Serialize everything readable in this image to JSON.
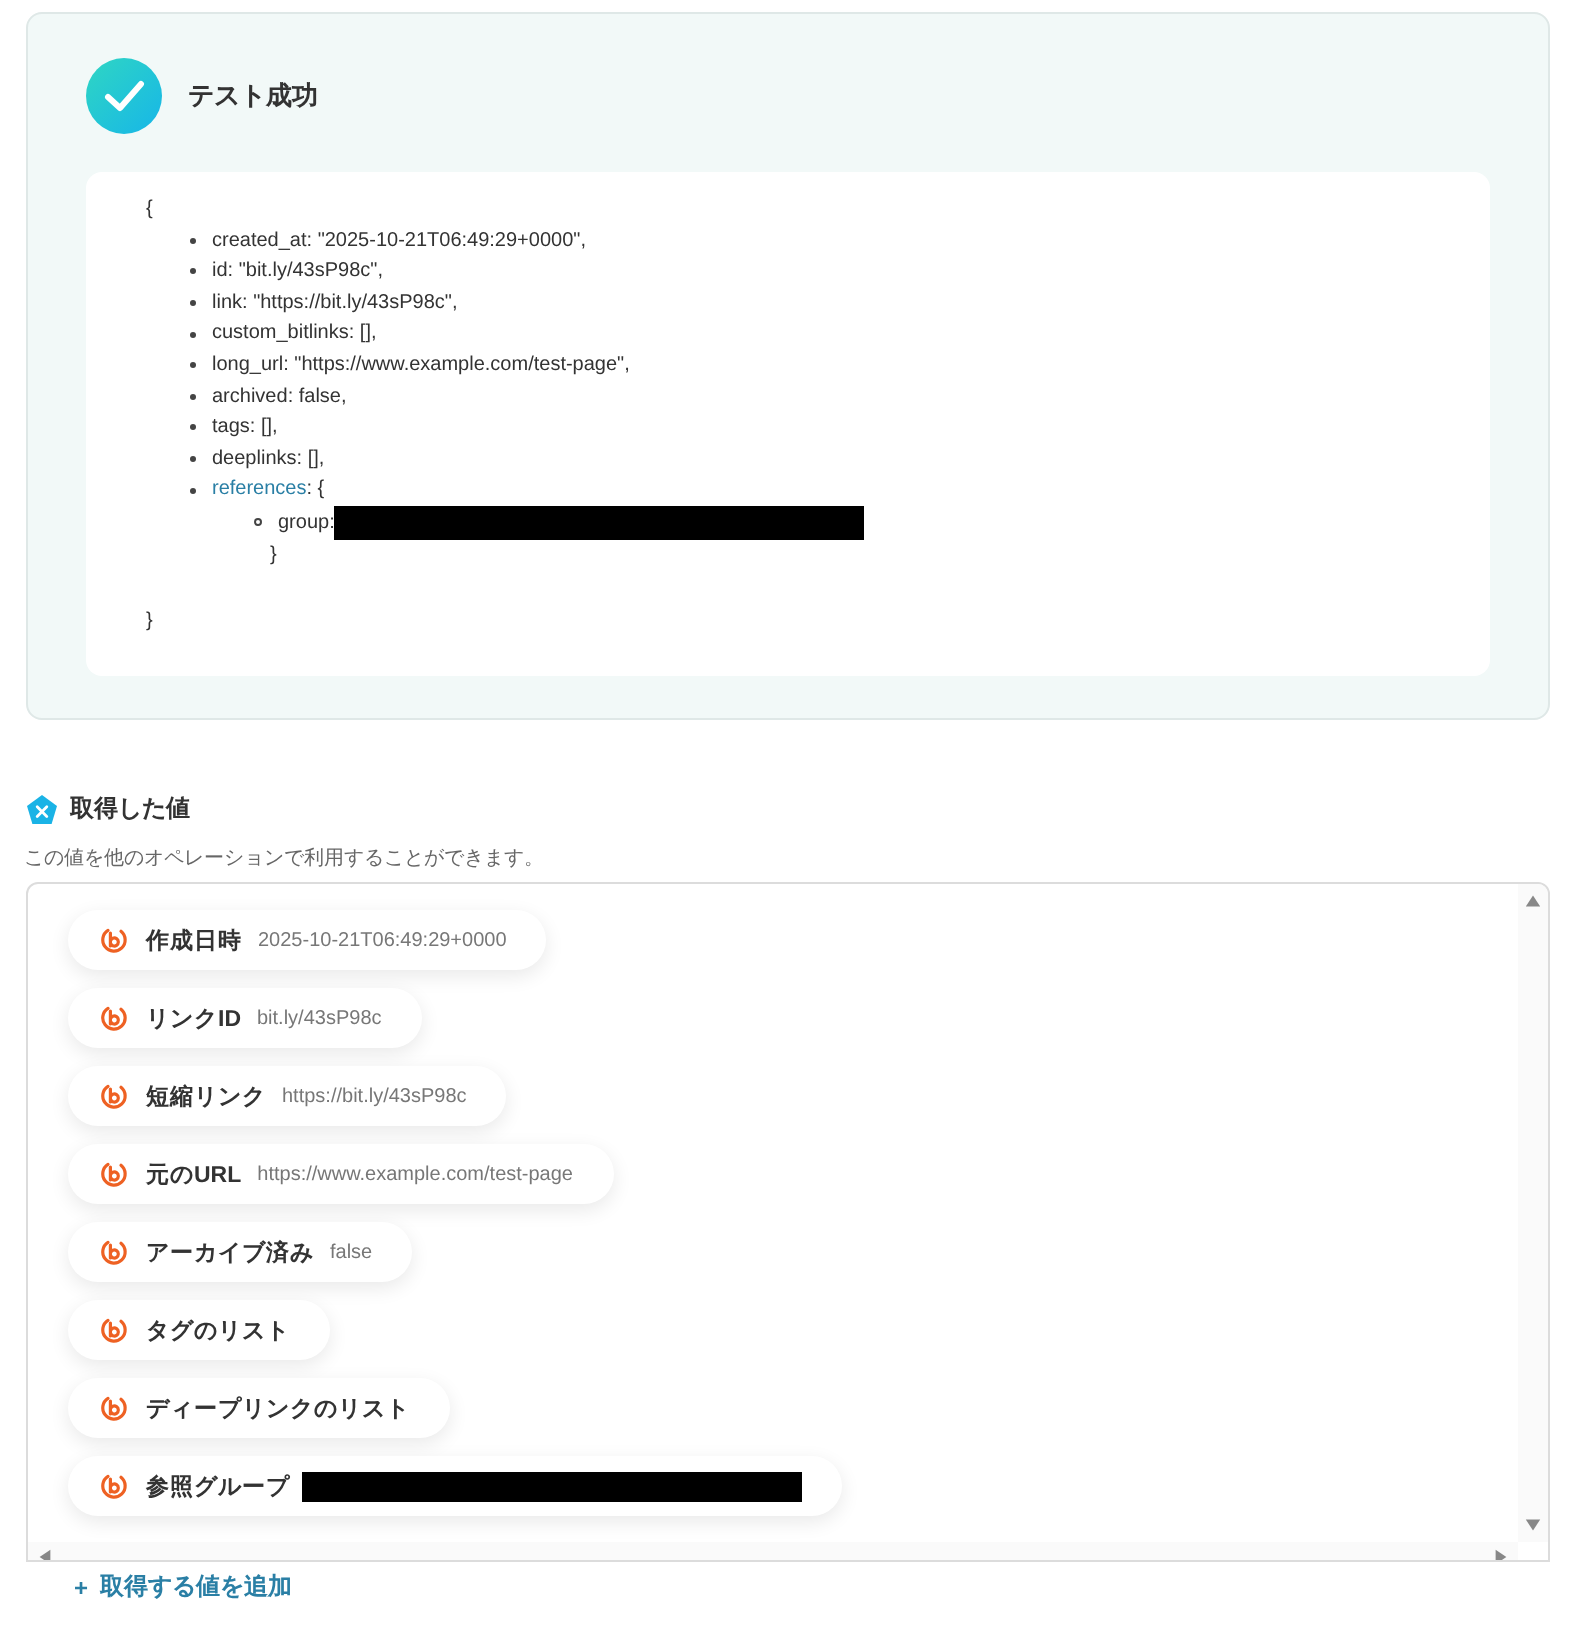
{
  "result": {
    "title": "テスト成功",
    "open_brace": "{",
    "close_brace": "}",
    "entries": [
      {
        "key": "created_at",
        "rest": ": \"2025-10-21T06:49:29+0000\",",
        "highlight": false
      },
      {
        "key": "id",
        "rest": ": \"bit.ly/43sP98c\",",
        "highlight": false
      },
      {
        "key": "link",
        "rest": ": \"https://bit.ly/43sP98c\",",
        "highlight": false
      },
      {
        "key": "custom_bitlinks",
        "rest": ": [],",
        "highlight": false
      },
      {
        "key": "long_url",
        "rest": ": \"https://www.example.com/test-page\",",
        "highlight": false
      },
      {
        "key": "archived",
        "rest": ": false,",
        "highlight": false
      },
      {
        "key": "tags",
        "rest": ": [],",
        "highlight": false
      },
      {
        "key": "deeplinks",
        "rest": ": [],",
        "highlight": false
      },
      {
        "key": "references",
        "rest": ": {",
        "highlight": true,
        "close": "}",
        "children": [
          {
            "key": "group",
            "rest": ":",
            "redacted": true
          }
        ]
      }
    ]
  },
  "values": {
    "title": "取得した値",
    "subtitle": "この値を他のオペレーションで利用することができます。",
    "items": [
      {
        "label": "作成日時",
        "value": "2025-10-21T06:49:29+0000"
      },
      {
        "label": "リンクID",
        "value": "bit.ly/43sP98c"
      },
      {
        "label": "短縮リンク",
        "value": "https://bit.ly/43sP98c"
      },
      {
        "label": "元のURL",
        "value": "https://www.example.com/test-page"
      },
      {
        "label": "アーカイブ済み",
        "value": "false"
      },
      {
        "label": "タグのリスト"
      },
      {
        "label": "ディープリンクのリスト"
      },
      {
        "label": "参照グループ",
        "redacted": true
      }
    ]
  },
  "add_button": {
    "icon": "+",
    "label": "取得する値を追加"
  }
}
